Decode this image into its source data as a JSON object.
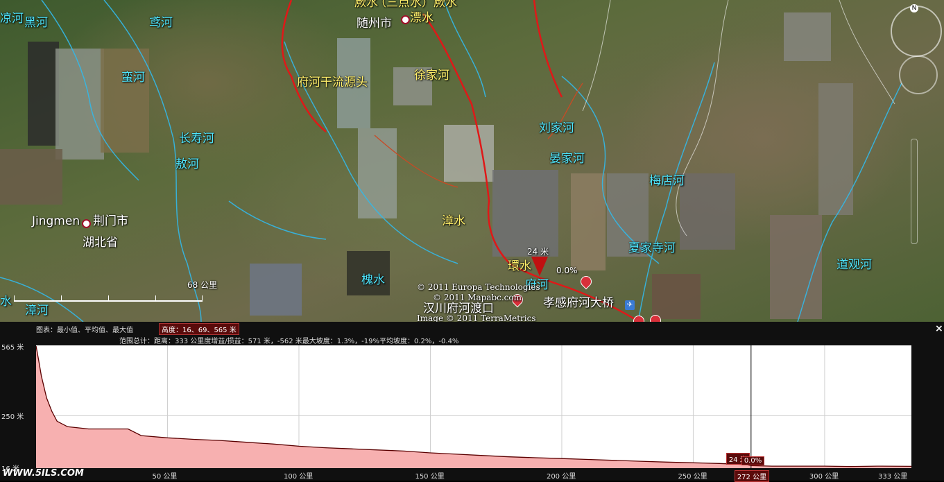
{
  "map": {
    "labels": {
      "liang": "凉河",
      "hei": "黑河",
      "yuan": "鸢河",
      "man": "蛮河",
      "changshou": "长寿河",
      "ao": "敖河",
      "zhang2": "漳河",
      "shui_left": "水",
      "jingmen_en": "Jingmen",
      "jingmen": "荆门市",
      "hubei": "湖北省",
      "jue": "厥水",
      "sandian": "（三点水）厥水",
      "suizhou": "随州市",
      "yun": "漂水",
      "xujia": "徐家河",
      "fuhe_source": "府河干流源头",
      "liujia": "刘家河",
      "yanjia": "晏家河",
      "meidian": "梅店河",
      "zhang": "漳水",
      "huai": "槐水",
      "huan": "環水",
      "fuhe": "府河",
      "xiajiasi": "夏家寺河",
      "daoguan": "道观河",
      "hanchuan": "汉川府河渡口",
      "xiaogan": "孝感府河大桥",
      "marker_elev": "24 米",
      "marker_pct": "0.0%"
    },
    "credits": {
      "europa": "© 2011 Europa Technologies",
      "mapabc": "© 2011 Mapabc.com",
      "terra": "Image © 2011 TerraMetrics"
    },
    "scale": "68 公里",
    "north": "N"
  },
  "panel": {
    "line1_prefix": "图表：最小值、平均值、最大值",
    "line1_value": "高度：16、69、565 米",
    "line2": "范围总计：距离：333 公里度增益/损益：571 米，-562 米最大坡度：1.3%，-19%平均坡度：0.2%，-0.4%",
    "close": "×",
    "watermark": "WWW.5ILS.COM"
  },
  "chart_data": {
    "type": "area",
    "title": "",
    "xlabel": "",
    "ylabel": "",
    "y_ticks": [
      "565 米",
      "250 米",
      "16 米"
    ],
    "x_ticks": [
      "50 公里",
      "100 公里",
      "150 公里",
      "200 公里",
      "250 公里",
      "300 公里",
      "333 公里"
    ],
    "ylim": [
      16,
      565
    ],
    "xlim": [
      0,
      333
    ],
    "x": [
      0,
      1,
      2,
      4,
      6,
      8,
      12,
      20,
      28,
      35,
      40,
      50,
      60,
      70,
      80,
      90,
      100,
      110,
      120,
      130,
      140,
      150,
      160,
      170,
      180,
      190,
      200,
      210,
      220,
      230,
      240,
      250,
      260,
      270,
      272,
      280,
      290,
      300,
      310,
      320,
      333
    ],
    "y": [
      565,
      500,
      430,
      330,
      270,
      225,
      200,
      190,
      190,
      190,
      160,
      150,
      143,
      138,
      130,
      122,
      112,
      105,
      100,
      95,
      90,
      82,
      76,
      70,
      64,
      60,
      56,
      52,
      48,
      44,
      40,
      37,
      34,
      29,
      24,
      22,
      22,
      22,
      20,
      22,
      21
    ],
    "cursor": {
      "x": 272,
      "x_label": "272 公里",
      "elevation_label": "24 米",
      "grade_label": "0.0%"
    },
    "fill_color": "#f7b0b0",
    "line_color": "#5a0000"
  }
}
